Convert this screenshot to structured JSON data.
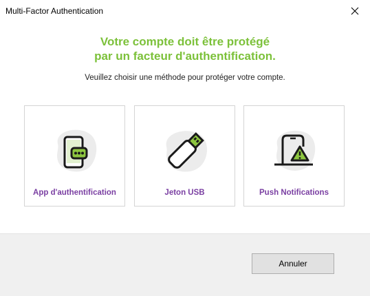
{
  "window": {
    "title": "Multi-Factor Authentication",
    "close_icon": "close-icon"
  },
  "main": {
    "heading_line1": "Votre compte doit être protégé",
    "heading_line2": "par un facteur d'authentification.",
    "subtitle": "Veuillez choisir une méthode pour protéger votre compte."
  },
  "methods": [
    {
      "label": "App d'authentification",
      "icon": "authenticator-app-icon"
    },
    {
      "label": "Jeton USB",
      "icon": "usb-token-icon"
    },
    {
      "label": "Push Notifications",
      "icon": "push-notification-icon"
    }
  ],
  "footer": {
    "cancel_label": "Annuler"
  },
  "colors": {
    "heading": "#7cc13a",
    "card_label": "#7a3fa2",
    "icon_green": "#8dc63f",
    "icon_stroke": "#1a1a1a",
    "icon_blob": "#ececec"
  }
}
